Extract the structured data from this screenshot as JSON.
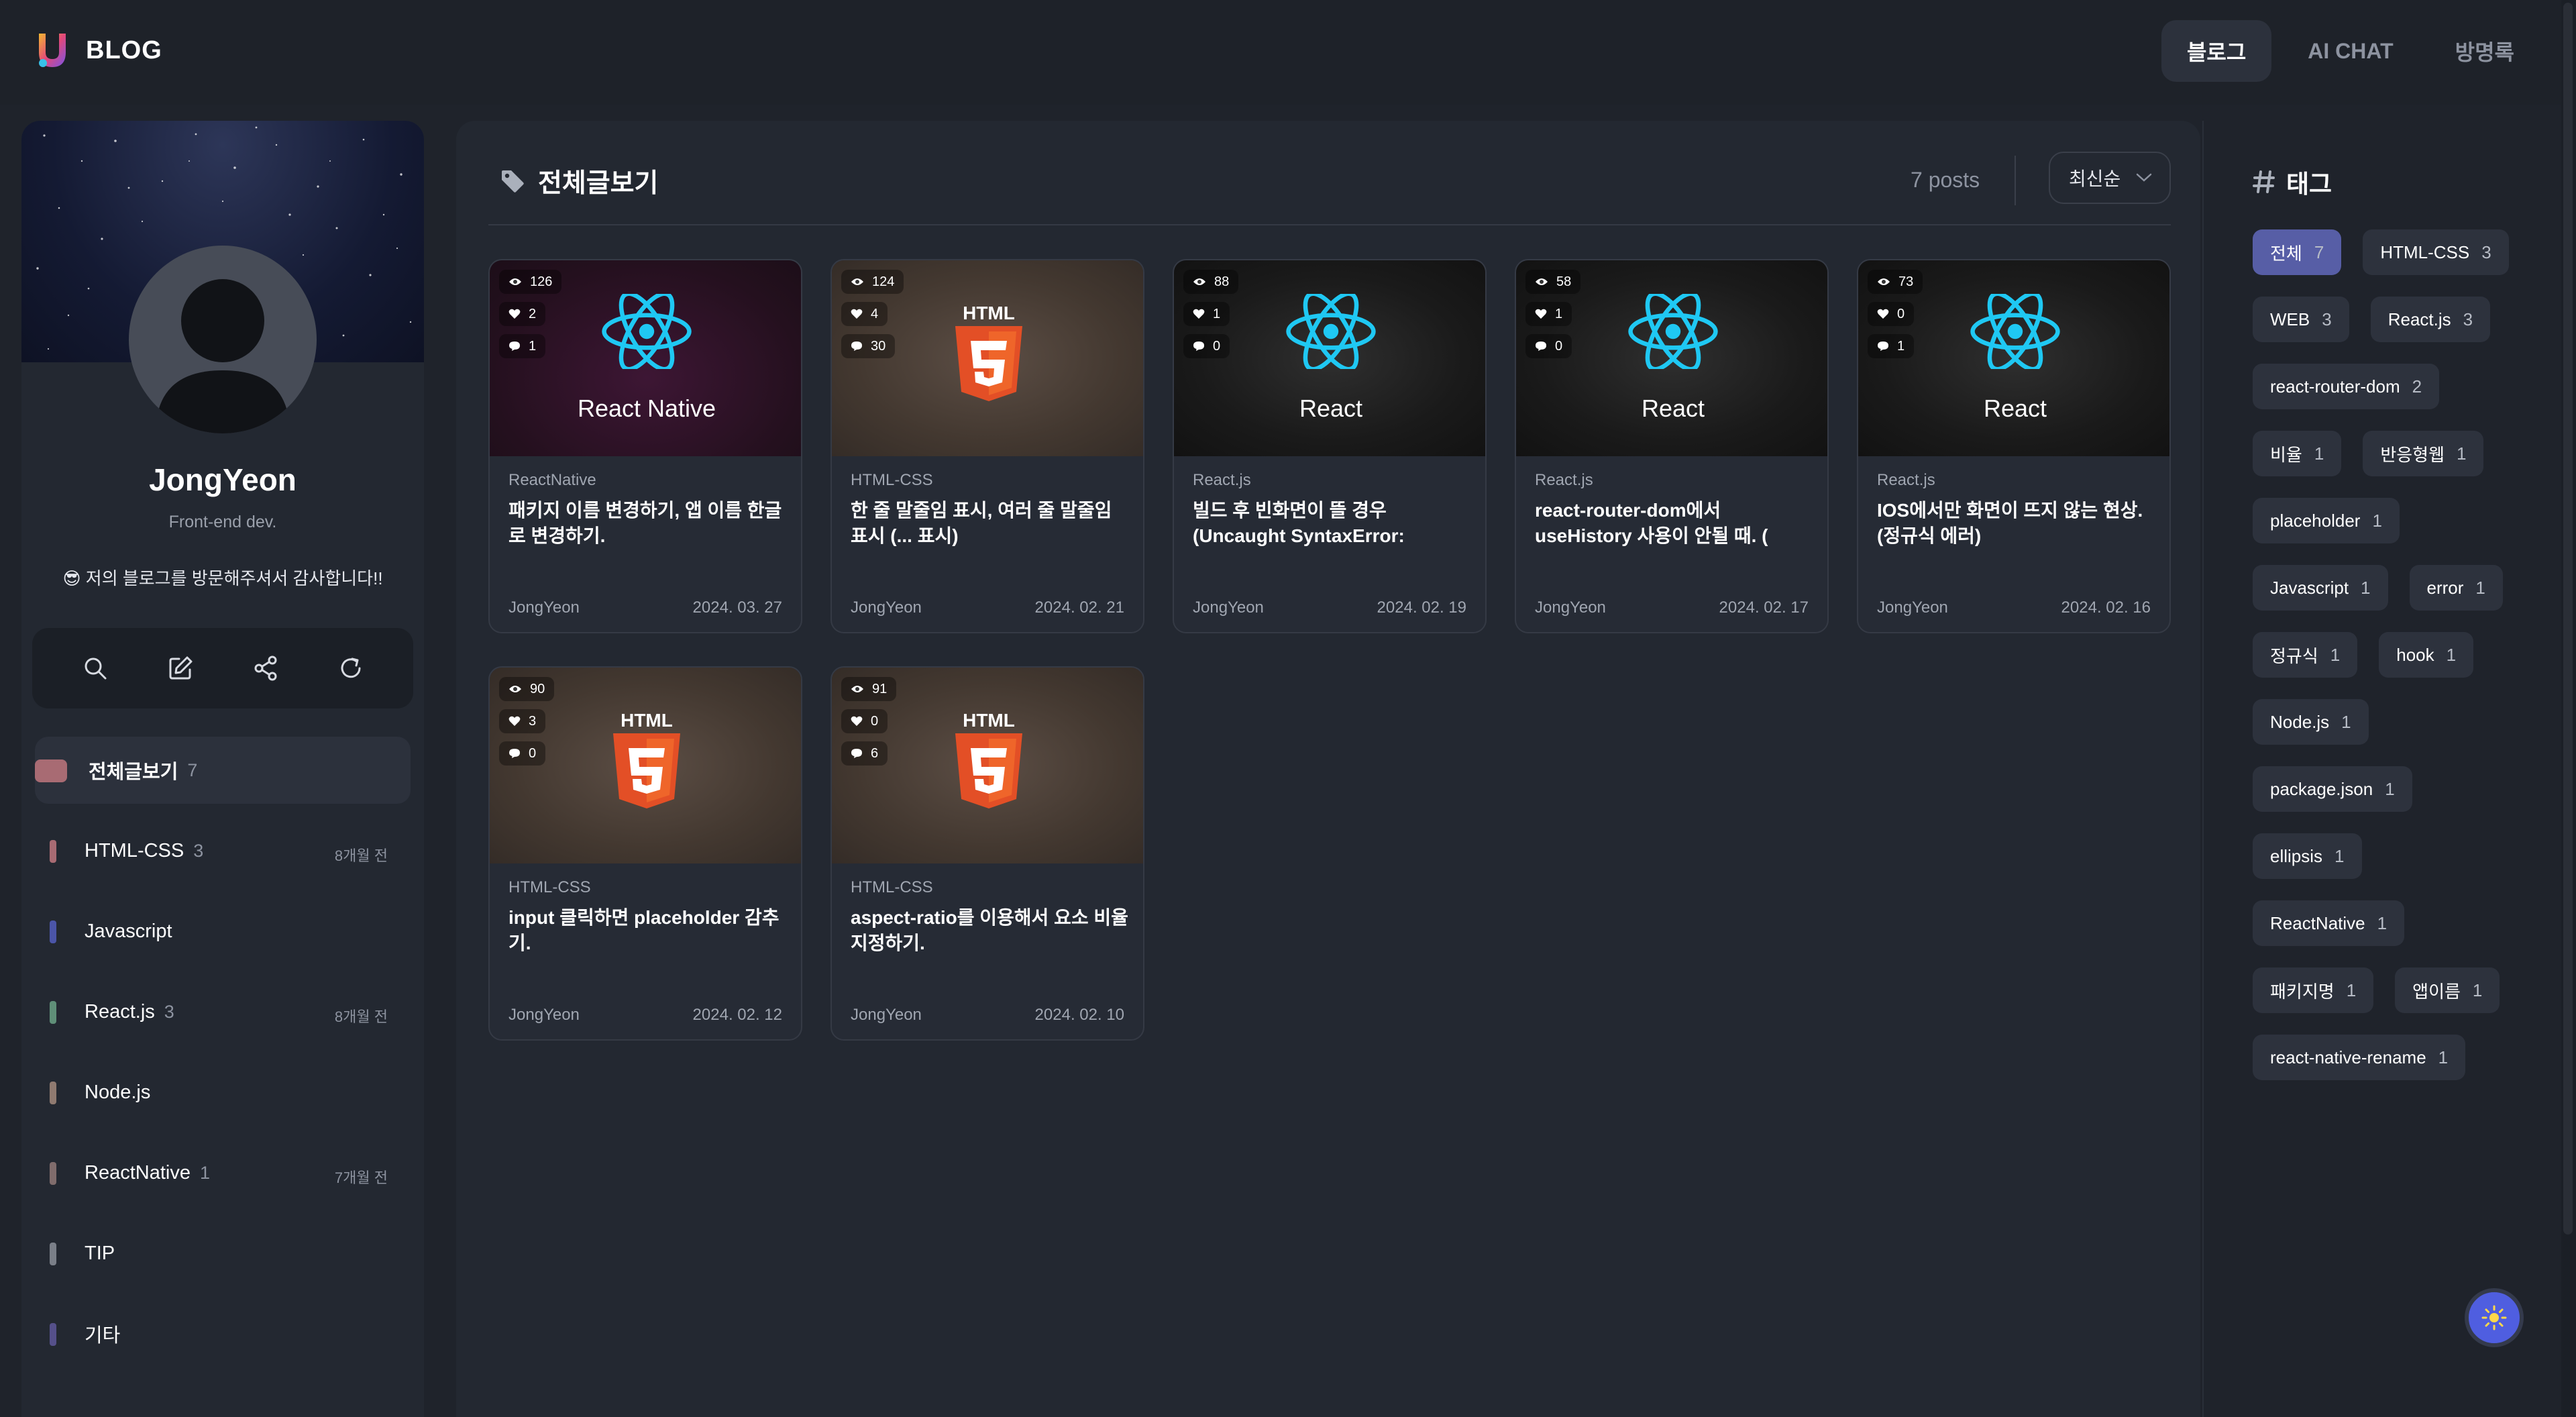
{
  "header": {
    "logo_text": "BLOG",
    "nav": [
      {
        "label": "블로그",
        "active": true
      },
      {
        "label": "AI CHAT",
        "active": false
      },
      {
        "label": "방명록",
        "active": false
      }
    ]
  },
  "profile": {
    "name": "JongYeon",
    "role": "Front-end dev.",
    "message": "😎 저의 블로그를 방문해주셔서 감사합니다!!"
  },
  "tools": [
    "search-icon",
    "edit-icon",
    "share-icon",
    "refresh-icon"
  ],
  "categories": [
    {
      "name": "전체글보기",
      "count": "7",
      "time": "",
      "color": "#a86b73",
      "active": true
    },
    {
      "name": "HTML-CSS",
      "count": "3",
      "time": "8개월 전",
      "color": "#a86b73"
    },
    {
      "name": "Javascript",
      "count": "",
      "time": "",
      "color": "#4b55a8"
    },
    {
      "name": "React.js",
      "count": "3",
      "time": "8개월 전",
      "color": "#5f8f78"
    },
    {
      "name": "Node.js",
      "count": "",
      "time": "",
      "color": "#8f7a70"
    },
    {
      "name": "ReactNative",
      "count": "1",
      "time": "7개월 전",
      "color": "#806c6c"
    },
    {
      "name": "TIP",
      "count": "",
      "time": "",
      "color": "#7a7f88"
    },
    {
      "name": "기타",
      "count": "",
      "time": "",
      "color": "#55508a"
    }
  ],
  "main": {
    "title": "전체글보기",
    "posts_count": "7 posts",
    "sort_label": "최신순"
  },
  "posts": [
    {
      "thumb": "react-native",
      "thumb_label": "React Native",
      "views": "126",
      "likes": "2",
      "comments": "1",
      "category": "ReactNative",
      "title": "패키지 이름 변경하기, 앱 이름 한글로 변경하기.",
      "author": "JongYeon",
      "date": "2024. 03. 27"
    },
    {
      "thumb": "html",
      "thumb_label": "HTML",
      "views": "124",
      "likes": "4",
      "comments": "30",
      "category": "HTML-CSS",
      "title": "한 줄 말줄임 표시, 여러 줄 말줄임 표시 (... 표시)",
      "author": "JongYeon",
      "date": "2024. 02. 21"
    },
    {
      "thumb": "react",
      "thumb_label": "React",
      "views": "88",
      "likes": "1",
      "comments": "0",
      "category": "React.js",
      "title": "빌드 후 빈화면이 뜰 경우 (Uncaught SyntaxError: Unexpected toke...",
      "author": "JongYeon",
      "date": "2024. 02. 19"
    },
    {
      "thumb": "react",
      "thumb_label": "React",
      "views": "58",
      "likes": "1",
      "comments": "0",
      "category": "React.js",
      "title": "react-router-dom에서 useHistory 사용이 안될 때. ( useNavigate ...",
      "author": "JongYeon",
      "date": "2024. 02. 17"
    },
    {
      "thumb": "react",
      "thumb_label": "React",
      "views": "73",
      "likes": "0",
      "comments": "1",
      "category": "React.js",
      "title": "IOS에서만 화면이 뜨지 않는 현상. (정규식 에러)",
      "author": "JongYeon",
      "date": "2024. 02. 16"
    },
    {
      "thumb": "html",
      "thumb_label": "HTML",
      "views": "90",
      "likes": "3",
      "comments": "0",
      "category": "HTML-CSS",
      "title": "input 클릭하면 placeholder 감추기.",
      "author": "JongYeon",
      "date": "2024. 02. 12"
    },
    {
      "thumb": "html",
      "thumb_label": "HTML",
      "views": "91",
      "likes": "0",
      "comments": "6",
      "category": "HTML-CSS",
      "title": "aspect-ratio를 이용해서 요소 비율 지정하기.",
      "author": "JongYeon",
      "date": "2024. 02. 10"
    }
  ],
  "tags_panel": {
    "title": "태그",
    "rows": [
      [
        {
          "name": "전체",
          "count": "7",
          "active": true
        },
        {
          "name": "HTML-CSS",
          "count": "3"
        }
      ],
      [
        {
          "name": "WEB",
          "count": "3"
        },
        {
          "name": "React.js",
          "count": "3"
        }
      ],
      [
        {
          "name": "react-router-dom",
          "count": "2"
        }
      ],
      [
        {
          "name": "비율",
          "count": "1"
        },
        {
          "name": "반응형웹",
          "count": "1"
        }
      ],
      [
        {
          "name": "placeholder",
          "count": "1"
        }
      ],
      [
        {
          "name": "Javascript",
          "count": "1"
        },
        {
          "name": "error",
          "count": "1"
        }
      ],
      [
        {
          "name": "정규식",
          "count": "1"
        },
        {
          "name": "hook",
          "count": "1"
        }
      ],
      [
        {
          "name": "Node.js",
          "count": "1"
        }
      ],
      [
        {
          "name": "package.json",
          "count": "1"
        }
      ],
      [
        {
          "name": "ellipsis",
          "count": "1"
        }
      ],
      [
        {
          "name": "ReactNative",
          "count": "1"
        }
      ],
      [
        {
          "name": "패키지명",
          "count": "1"
        },
        {
          "name": "앱이름",
          "count": "1"
        }
      ],
      [
        {
          "name": "react-native-rename",
          "count": "1"
        }
      ]
    ]
  }
}
